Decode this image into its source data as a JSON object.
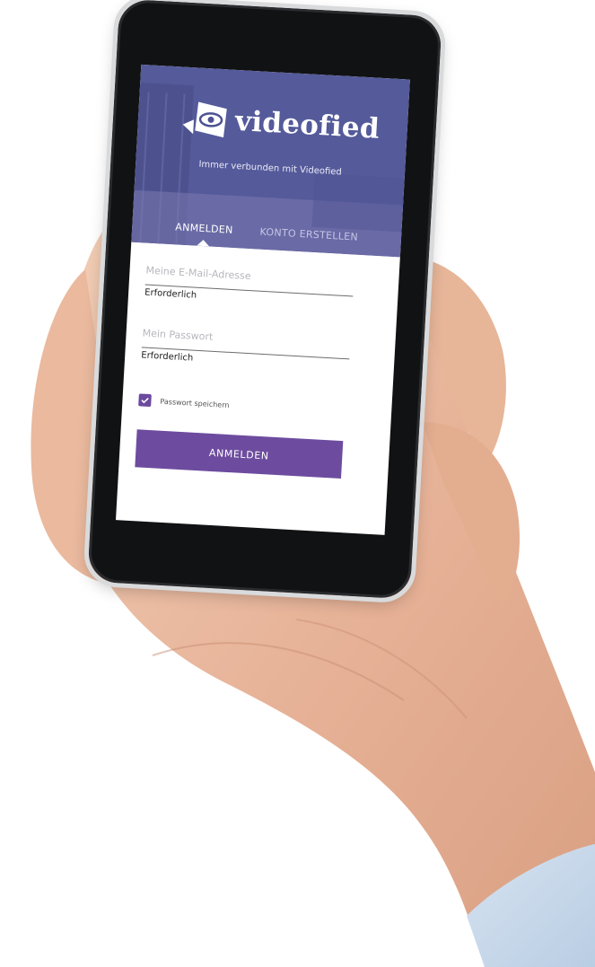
{
  "brand": {
    "name": "videofied",
    "tagline": "Immer verbunden mit Videofied"
  },
  "tabs": [
    {
      "label": "ANMELDEN",
      "active": true
    },
    {
      "label": "KONTO ERSTELLEN",
      "active": false
    }
  ],
  "form": {
    "email": {
      "placeholder": "Meine E-Mail-Adresse",
      "helper": "Erforderlich"
    },
    "password": {
      "placeholder": "Mein Passwort",
      "helper": "Erforderlich"
    },
    "remember": {
      "label": "Passwort speichern",
      "checked": true
    },
    "submit_label": "ANMELDEN"
  },
  "colors": {
    "header": "#4d5292",
    "accent": "#6d4c9f",
    "phone": "#111214",
    "skin": "#e8b99a"
  }
}
